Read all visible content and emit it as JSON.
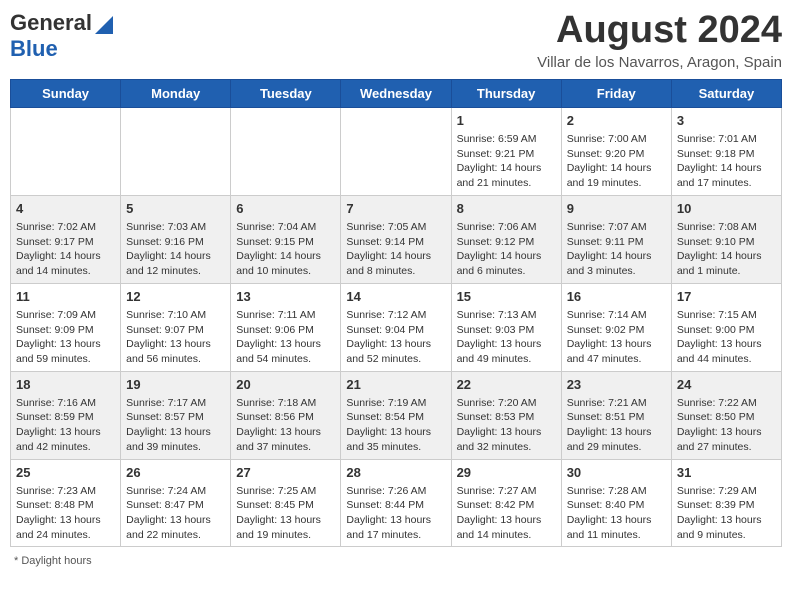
{
  "header": {
    "logo_line1": "General",
    "logo_line2": "Blue",
    "month_title": "August 2024",
    "location": "Villar de los Navarros, Aragon, Spain"
  },
  "days_of_week": [
    "Sunday",
    "Monday",
    "Tuesday",
    "Wednesday",
    "Thursday",
    "Friday",
    "Saturday"
  ],
  "footer": {
    "note": "Daylight hours"
  },
  "weeks": [
    {
      "days": [
        {
          "number": "",
          "info": ""
        },
        {
          "number": "",
          "info": ""
        },
        {
          "number": "",
          "info": ""
        },
        {
          "number": "",
          "info": ""
        },
        {
          "number": "1",
          "info": "Sunrise: 6:59 AM\nSunset: 9:21 PM\nDaylight: 14 hours and 21 minutes."
        },
        {
          "number": "2",
          "info": "Sunrise: 7:00 AM\nSunset: 9:20 PM\nDaylight: 14 hours and 19 minutes."
        },
        {
          "number": "3",
          "info": "Sunrise: 7:01 AM\nSunset: 9:18 PM\nDaylight: 14 hours and 17 minutes."
        }
      ]
    },
    {
      "days": [
        {
          "number": "4",
          "info": "Sunrise: 7:02 AM\nSunset: 9:17 PM\nDaylight: 14 hours and 14 minutes."
        },
        {
          "number": "5",
          "info": "Sunrise: 7:03 AM\nSunset: 9:16 PM\nDaylight: 14 hours and 12 minutes."
        },
        {
          "number": "6",
          "info": "Sunrise: 7:04 AM\nSunset: 9:15 PM\nDaylight: 14 hours and 10 minutes."
        },
        {
          "number": "7",
          "info": "Sunrise: 7:05 AM\nSunset: 9:14 PM\nDaylight: 14 hours and 8 minutes."
        },
        {
          "number": "8",
          "info": "Sunrise: 7:06 AM\nSunset: 9:12 PM\nDaylight: 14 hours and 6 minutes."
        },
        {
          "number": "9",
          "info": "Sunrise: 7:07 AM\nSunset: 9:11 PM\nDaylight: 14 hours and 3 minutes."
        },
        {
          "number": "10",
          "info": "Sunrise: 7:08 AM\nSunset: 9:10 PM\nDaylight: 14 hours and 1 minute."
        }
      ]
    },
    {
      "days": [
        {
          "number": "11",
          "info": "Sunrise: 7:09 AM\nSunset: 9:09 PM\nDaylight: 13 hours and 59 minutes."
        },
        {
          "number": "12",
          "info": "Sunrise: 7:10 AM\nSunset: 9:07 PM\nDaylight: 13 hours and 56 minutes."
        },
        {
          "number": "13",
          "info": "Sunrise: 7:11 AM\nSunset: 9:06 PM\nDaylight: 13 hours and 54 minutes."
        },
        {
          "number": "14",
          "info": "Sunrise: 7:12 AM\nSunset: 9:04 PM\nDaylight: 13 hours and 52 minutes."
        },
        {
          "number": "15",
          "info": "Sunrise: 7:13 AM\nSunset: 9:03 PM\nDaylight: 13 hours and 49 minutes."
        },
        {
          "number": "16",
          "info": "Sunrise: 7:14 AM\nSunset: 9:02 PM\nDaylight: 13 hours and 47 minutes."
        },
        {
          "number": "17",
          "info": "Sunrise: 7:15 AM\nSunset: 9:00 PM\nDaylight: 13 hours and 44 minutes."
        }
      ]
    },
    {
      "days": [
        {
          "number": "18",
          "info": "Sunrise: 7:16 AM\nSunset: 8:59 PM\nDaylight: 13 hours and 42 minutes."
        },
        {
          "number": "19",
          "info": "Sunrise: 7:17 AM\nSunset: 8:57 PM\nDaylight: 13 hours and 39 minutes."
        },
        {
          "number": "20",
          "info": "Sunrise: 7:18 AM\nSunset: 8:56 PM\nDaylight: 13 hours and 37 minutes."
        },
        {
          "number": "21",
          "info": "Sunrise: 7:19 AM\nSunset: 8:54 PM\nDaylight: 13 hours and 35 minutes."
        },
        {
          "number": "22",
          "info": "Sunrise: 7:20 AM\nSunset: 8:53 PM\nDaylight: 13 hours and 32 minutes."
        },
        {
          "number": "23",
          "info": "Sunrise: 7:21 AM\nSunset: 8:51 PM\nDaylight: 13 hours and 29 minutes."
        },
        {
          "number": "24",
          "info": "Sunrise: 7:22 AM\nSunset: 8:50 PM\nDaylight: 13 hours and 27 minutes."
        }
      ]
    },
    {
      "days": [
        {
          "number": "25",
          "info": "Sunrise: 7:23 AM\nSunset: 8:48 PM\nDaylight: 13 hours and 24 minutes."
        },
        {
          "number": "26",
          "info": "Sunrise: 7:24 AM\nSunset: 8:47 PM\nDaylight: 13 hours and 22 minutes."
        },
        {
          "number": "27",
          "info": "Sunrise: 7:25 AM\nSunset: 8:45 PM\nDaylight: 13 hours and 19 minutes."
        },
        {
          "number": "28",
          "info": "Sunrise: 7:26 AM\nSunset: 8:44 PM\nDaylight: 13 hours and 17 minutes."
        },
        {
          "number": "29",
          "info": "Sunrise: 7:27 AM\nSunset: 8:42 PM\nDaylight: 13 hours and 14 minutes."
        },
        {
          "number": "30",
          "info": "Sunrise: 7:28 AM\nSunset: 8:40 PM\nDaylight: 13 hours and 11 minutes."
        },
        {
          "number": "31",
          "info": "Sunrise: 7:29 AM\nSunset: 8:39 PM\nDaylight: 13 hours and 9 minutes."
        }
      ]
    }
  ]
}
